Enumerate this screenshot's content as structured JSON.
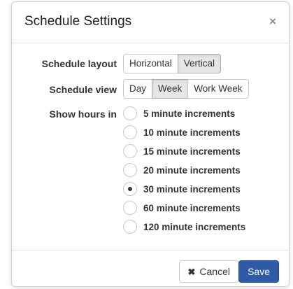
{
  "dialog": {
    "title": "Schedule Settings",
    "close_symbol": "×"
  },
  "layout": {
    "label": "Schedule layout",
    "options": [
      "Horizontal",
      "Vertical"
    ],
    "selected": "Vertical"
  },
  "view": {
    "label": "Schedule view",
    "options": [
      "Day",
      "Week",
      "Work Week"
    ],
    "selected": "Week"
  },
  "hours": {
    "label": "Show hours in",
    "options": [
      "5 minute increments",
      "10 minute increments",
      "15 minute increments",
      "20 minute increments",
      "30 minute increments",
      "60 minute increments",
      "120 minute increments"
    ],
    "selected": "30 minute increments"
  },
  "footer": {
    "cancel_icon": "✖",
    "cancel_label": "Cancel",
    "save_label": "Save"
  },
  "colors": {
    "primary": "#2f5aa6",
    "active_segment": "#e6e6e6"
  }
}
